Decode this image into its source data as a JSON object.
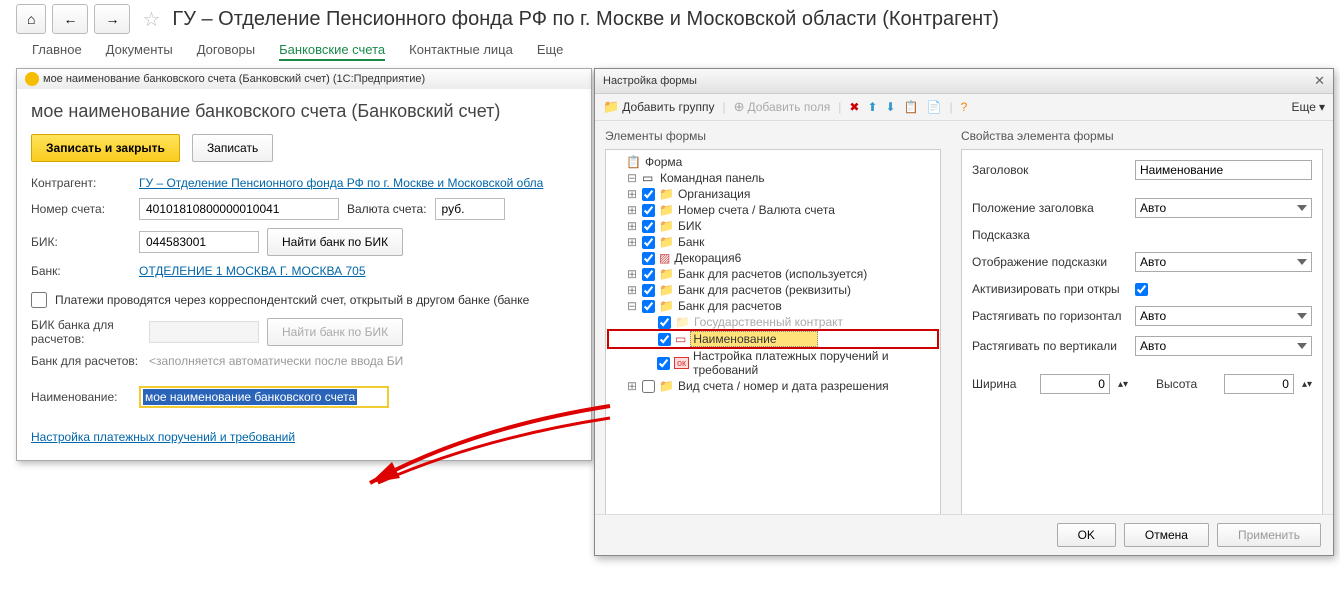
{
  "topBar": {
    "title": "ГУ – Отделение Пенсионного фонда РФ по г. Москве и Московской области (Контрагент)"
  },
  "tabs": {
    "t1": "Главное",
    "t2": "Документы",
    "t3": "Договоры",
    "t4": "Банковские счета",
    "t5": "Контактные лица",
    "t6": "Еще"
  },
  "form": {
    "windowTitle": "мое наименование банковского счета (Банковский счет)    (1С:Предприятие)",
    "heading": "мое наименование банковского счета (Банковский счет)",
    "saveClose": "Записать и закрыть",
    "save": "Записать",
    "counterparty_lbl": "Контрагент:",
    "counterparty_val": "ГУ – Отделение Пенсионного фонда РФ по г. Москве и Московской обла",
    "accno_lbl": "Номер счета:",
    "accno_val": "40101810800000010041",
    "currency_lbl": "Валюта счета:",
    "currency_val": "руб.",
    "bik_lbl": "БИК:",
    "bik_val": "044583001",
    "findbik": "Найти банк по БИК",
    "bank_lbl": "Банк:",
    "bank_val": "ОТДЕЛЕНИЕ 1 МОСКВА Г. МОСКВА 705",
    "corr_check": "Платежи проводятся через корреспондентский счет, открытый в другом банке (банке",
    "bik2_lbl": "БИК банка для расчетов:",
    "findbik2": "Найти банк по БИК",
    "bank2_lbl": "Банк для расчетов:",
    "bank2_ph": "<заполняется автоматически после ввода БИ",
    "name_lbl": "Наименование:",
    "name_val": "мое наименование банковского счета",
    "config_link": "Настройка платежных поручений и требований"
  },
  "dialog": {
    "title": "Настройка формы",
    "addGroup": "Добавить группу",
    "addFields": "Добавить поля",
    "more": "Еще",
    "col1": "Элементы формы",
    "col2": "Свойства элемента формы",
    "tree": {
      "root": "Форма",
      "i1": "Командная панель",
      "i2": "Организация",
      "i3": "Номер счета / Валюта счета",
      "i4": "БИК",
      "i5": "Банк",
      "i6": "Декорация6",
      "i7": "Банк для расчетов (используется)",
      "i8": "Банк для расчетов (реквизиты)",
      "i9": "Банк для расчетов",
      "i10": "Государственный контракт",
      "i11": "Наименование",
      "i12": "Настройка платежных поручений и требований",
      "i13": "Вид счета / номер и дата разрешения"
    },
    "props": {
      "p1": "Заголовок",
      "p1v": "Наименование",
      "p2": "Положение заголовка",
      "p2v": "Авто",
      "p3": "Подсказка",
      "p4": "Отображение подсказки",
      "p4v": "Авто",
      "p5": "Активизировать при откры",
      "p6": "Растягивать по горизонтал",
      "p6v": "Авто",
      "p7": "Растягивать по вертикали",
      "p7v": "Авто",
      "p8": "Ширина",
      "p8v": "0",
      "p9": "Высота",
      "p9v": "0"
    },
    "ok": "OK",
    "cancel": "Отмена",
    "apply": "Применить"
  }
}
